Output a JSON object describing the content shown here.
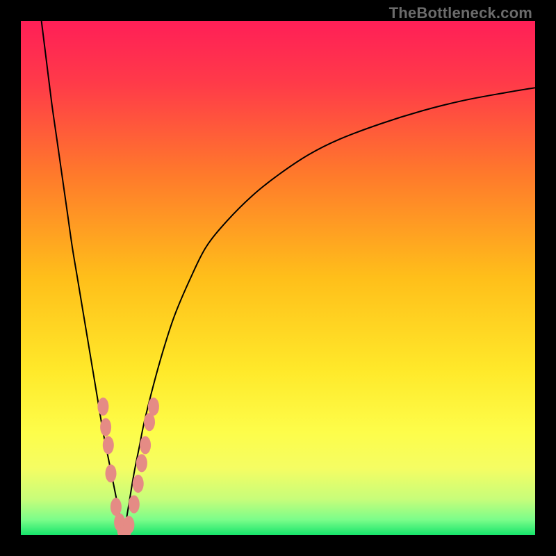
{
  "watermark": "TheBottleneck.com",
  "chart_data": {
    "type": "line",
    "title": "",
    "xlabel": "",
    "ylabel": "",
    "xlim": [
      0,
      100
    ],
    "ylim": [
      0,
      100
    ],
    "legend": false,
    "grid": false,
    "background_gradient": {
      "stops": [
        {
          "pos": 0.0,
          "color": "#ff1f57"
        },
        {
          "pos": 0.12,
          "color": "#ff3a49"
        },
        {
          "pos": 0.3,
          "color": "#ff7a2b"
        },
        {
          "pos": 0.5,
          "color": "#ffbf1a"
        },
        {
          "pos": 0.68,
          "color": "#ffe92a"
        },
        {
          "pos": 0.8,
          "color": "#fdfd4a"
        },
        {
          "pos": 0.87,
          "color": "#f5fd63"
        },
        {
          "pos": 0.93,
          "color": "#c7fd7a"
        },
        {
          "pos": 0.97,
          "color": "#7bfd8a"
        },
        {
          "pos": 1.0,
          "color": "#16e46b"
        }
      ]
    },
    "series": [
      {
        "name": "left-branch",
        "x": [
          4,
          5,
          6,
          7,
          8,
          9,
          10,
          11,
          12,
          13,
          14,
          15,
          16,
          17,
          18,
          19,
          20
        ],
        "y": [
          100,
          92,
          84,
          77,
          70,
          63,
          56,
          50,
          44,
          38,
          32,
          26,
          20,
          15,
          10,
          5,
          0
        ],
        "color": "#000000",
        "width": 2
      },
      {
        "name": "right-branch",
        "x": [
          20,
          21,
          22,
          23,
          24,
          26,
          28,
          30,
          33,
          36,
          40,
          45,
          50,
          56,
          62,
          70,
          78,
          86,
          94,
          100
        ],
        "y": [
          0,
          6,
          12,
          17,
          22,
          30,
          37,
          43,
          50,
          56,
          61,
          66,
          70,
          74,
          77,
          80,
          82.5,
          84.5,
          86,
          87
        ],
        "color": "#000000",
        "width": 2
      }
    ],
    "markers": {
      "name": "scatter-points",
      "color": "#e58b85",
      "rx": 4.5,
      "ry": 6.5,
      "points": [
        {
          "x": 16.0,
          "y": 25.0
        },
        {
          "x": 16.5,
          "y": 21.0
        },
        {
          "x": 17.0,
          "y": 17.5
        },
        {
          "x": 17.5,
          "y": 12.0
        },
        {
          "x": 18.5,
          "y": 5.5
        },
        {
          "x": 19.2,
          "y": 2.5
        },
        {
          "x": 19.8,
          "y": 1.0
        },
        {
          "x": 20.4,
          "y": 1.0
        },
        {
          "x": 21.0,
          "y": 2.0
        },
        {
          "x": 22.0,
          "y": 6.0
        },
        {
          "x": 22.8,
          "y": 10.0
        },
        {
          "x": 23.5,
          "y": 14.0
        },
        {
          "x": 24.2,
          "y": 17.5
        },
        {
          "x": 25.0,
          "y": 22.0
        },
        {
          "x": 25.8,
          "y": 25.0
        }
      ]
    }
  }
}
